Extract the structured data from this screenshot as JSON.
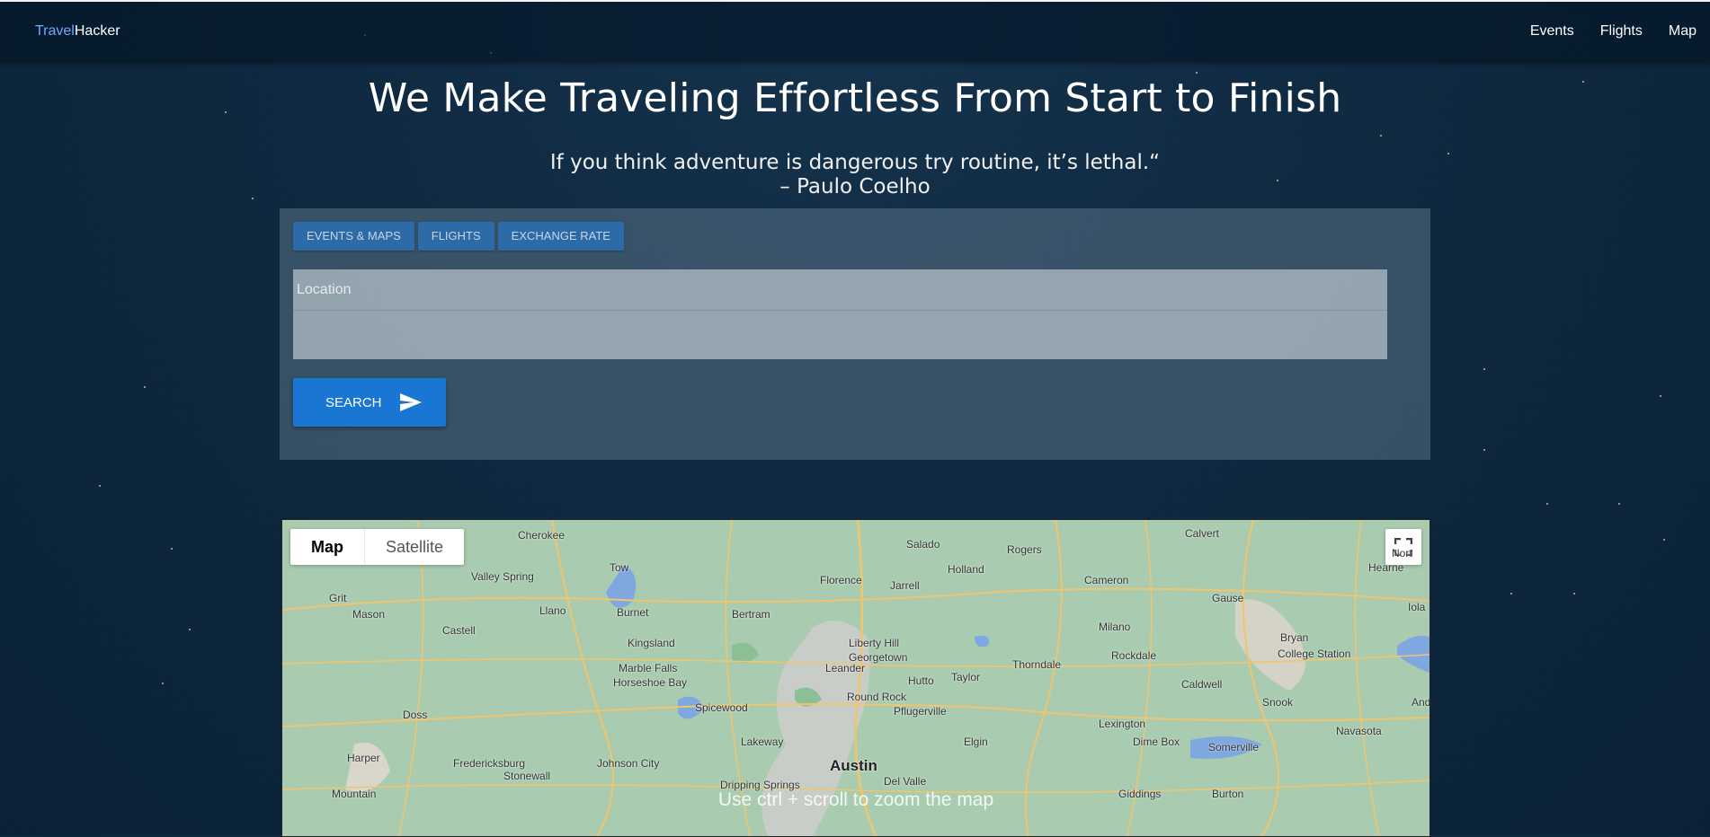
{
  "navbar": {
    "brand_part1": "Travel",
    "brand_part2": "Hacker",
    "links": [
      "Events",
      "Flights",
      "Map"
    ]
  },
  "hero": {
    "title": "We Make Traveling Effortless From Start to Finish",
    "quote_line1": "If you think adventure is dangerous try routine, it’s lethal.“",
    "quote_line2": "– Paulo Coelho"
  },
  "search_panel": {
    "tabs": [
      "EVENTS & MAPS",
      "FLIGHTS",
      "EXCHANGE RATE"
    ],
    "location_placeholder": "Location",
    "search_label": "SEARCH"
  },
  "map": {
    "toggle_map": "Map",
    "toggle_satellite": "Satellite",
    "hint": "Use ctrl + scroll to zoom the map",
    "places": [
      "Cherokee",
      "Salado",
      "Rogers",
      "Calvert",
      "Valley Spring",
      "Tow",
      "Florence",
      "Holland",
      "Hearne",
      "Grit",
      "Jarrell",
      "Cameron",
      "Gause",
      "Mason",
      "Llano",
      "Burnet",
      "Bertram",
      "Castell",
      "Kingsland",
      "Liberty Hill",
      "Georgetown",
      "Milano",
      "Bryan",
      "College Station",
      "Marble Falls",
      "Leander",
      "Thorndale",
      "Rockdale",
      "Horseshoe Bay",
      "Hutto",
      "Taylor",
      "Caldwell",
      "Snook",
      "Spicewood",
      "Round Rock",
      "Pflugerville",
      "Doss",
      "Lexington",
      "Navasota",
      "Lakeway",
      "Elgin",
      "Dime Box",
      "Somerville",
      "Harper",
      "Fredericksburg",
      "Johnson City",
      "Austin",
      "Stonewall",
      "Del Valle",
      "Dripping Springs",
      "Mountain",
      "Giddings",
      "Burton",
      "Iola",
      "Ande",
      "Nort"
    ],
    "accent_color": "#1976d2"
  }
}
